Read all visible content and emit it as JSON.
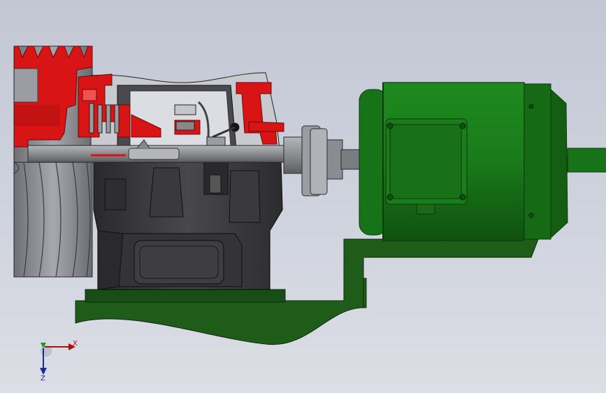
{
  "viewport": {
    "background_top": "#c2c7d4",
    "background_bottom": "#dcdee6"
  },
  "model": {
    "section_color": "#d81414",
    "housing_color": "#3c3c3e",
    "motor_color": "#1d7a1d",
    "base_color": "#1f5c1a",
    "shaft_color": "#8a8c90",
    "pulley_color": "#9a9ca2"
  },
  "triad": {
    "x_label": "X",
    "z_label": "Z",
    "x_color": "#b01010",
    "z_color": "#1a2aa0",
    "y_color": "#10a020"
  }
}
